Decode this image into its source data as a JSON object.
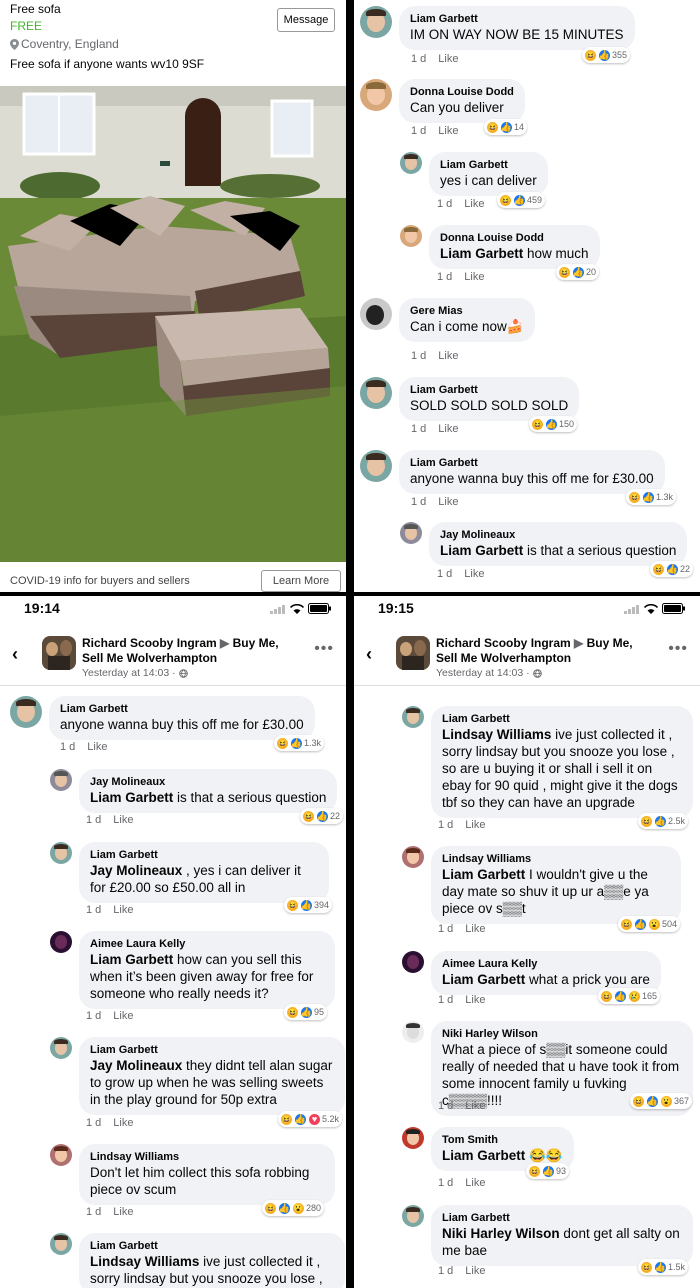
{
  "marketplace": {
    "title": "Free sofa",
    "price": "FREE",
    "location": "Coventry, England",
    "description": "Free sofa if anyone wants wv10 9SF",
    "message_button": "Message",
    "covid_text": "COVID-19 info for buyers and sellers",
    "learn_more": "Learn More"
  },
  "ui": {
    "age": "1 d",
    "like": "Like"
  },
  "colors": {
    "accent": "#1877f2",
    "price_green": "#42b72a",
    "bubble": "#f0f2f5"
  },
  "status": {
    "time3": "19:14",
    "time4": "19:15"
  },
  "post": {
    "poster": "Richard Scooby Ingram",
    "group_line1": "Buy Me,",
    "group_line2": "Sell Me Wolverhampton",
    "when": "Yesterday at 14:03 · "
  },
  "p2": [
    {
      "name": "Liam Garbett",
      "text": "IM ON WAY NOW BE 15 MINUTES",
      "count": "355"
    },
    {
      "name": "Donna Louise Dodd",
      "text": "Can you deliver",
      "count": "14"
    },
    {
      "name": "Liam Garbett",
      "text": "yes i can deliver",
      "count": "459"
    },
    {
      "name": "Donna Louise Dodd",
      "tag": "Liam Garbett",
      "text": " how much",
      "count": "20"
    },
    {
      "name": "Gere Mias",
      "text": "Can i come now"
    },
    {
      "name": "Liam Garbett",
      "text": "SOLD SOLD SOLD SOLD",
      "count": "150"
    },
    {
      "name": "Liam Garbett",
      "text": "anyone wanna buy this off me for £30.00",
      "count": "1.3k"
    },
    {
      "name": "Jay Molineaux",
      "tag": "Liam Garbett",
      "text": "  is that a serious question",
      "count": "22"
    }
  ],
  "p3": [
    {
      "name": "Liam Garbett",
      "text": "anyone wanna buy this off me for £30.00",
      "count": "1.3k"
    },
    {
      "name": "Jay Molineaux",
      "tag": "Liam Garbett",
      "text": "  is that a serious question",
      "count": "22"
    },
    {
      "name": "Liam Garbett",
      "tag": "Jay Molineaux",
      "text": " , yes i can deliver it for £20.00 so £50.00 all in",
      "count": "394"
    },
    {
      "name": "Aimee Laura Kelly",
      "tag": "Liam Garbett",
      "text": "  how can you sell this when it’s been given away for free for someone who really needs it?",
      "count": "95"
    },
    {
      "name": "Liam Garbett",
      "tag": "Jay Molineaux",
      "text": " they didnt tell alan sugar to grow up when he was selling sweets in the play ground for 50p extra",
      "count": "5.2k"
    },
    {
      "name": "Lindsay Williams",
      "text": "Don't let him collect this sofa robbing piece ov scum",
      "count": "280"
    },
    {
      "name": "Liam Garbett",
      "tag": "Lindsay Williams",
      "text": "  ive just collected it , sorry lindsay but you snooze you lose ,"
    }
  ],
  "p4": [
    {
      "name": "Liam Garbett",
      "tag": "Lindsay Williams",
      "text": "  ive just collected it , sorry lindsay but you snooze you lose , so are u buying it or shall i sell it on ebay for 90 quid , might give it the dogs tbf so they can have an upgrade",
      "count": "2.5k"
    },
    {
      "name": "Lindsay Williams",
      "tag": "Liam Garbett",
      "text": " I wouldn't give u the day mate so shuv it up ur a▒▒e ya piece ov s▒▒t",
      "count": "504"
    },
    {
      "name": "Aimee Laura Kelly",
      "tag": "Liam Garbett",
      "text": "  what a prick you are",
      "count": "165"
    },
    {
      "name": "Niki Harley Wilson",
      "text": "What a piece of s▒▒it someone could really of needed that u have took it from some innocent family u fuvking c▒▒▒▒!!!!",
      "count": "367"
    },
    {
      "name": "Tom Smith",
      "tag": "Liam Garbett",
      "text": " 😂😂",
      "count": "93"
    },
    {
      "name": "Liam Garbett",
      "tag": "Niki Harley Wilson",
      "text": "  dont get all salty on me bae",
      "count": "1.5k"
    }
  ]
}
